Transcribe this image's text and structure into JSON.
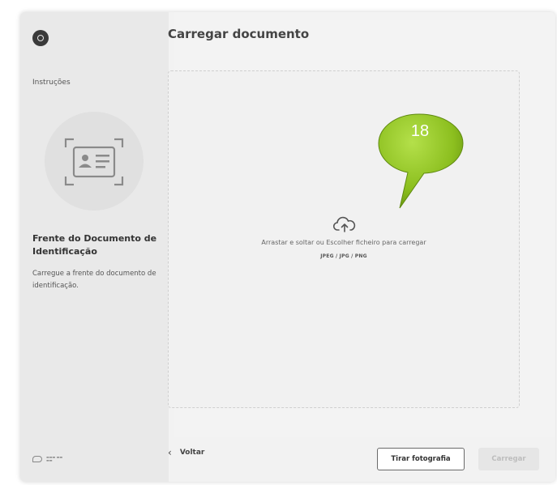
{
  "sidebar": {
    "instructions_label": "Instruções",
    "document_title": "Frente do Documento de Identificação",
    "document_description": "Carregue a frente do documento de identificação.",
    "info_icon": "info-icon",
    "id_card_icon": "id-card-icon",
    "brand_logo": "brand-logo"
  },
  "main": {
    "title": "Carregar documento",
    "dropzone": {
      "icon": "cloud-upload-icon",
      "instruction": "Arrastar e soltar ou Escolher ficheiro para carregar",
      "formats": "JPEG / JPG / PNG"
    },
    "callout": {
      "label": "18",
      "color": "#8cbf1f"
    }
  },
  "footer": {
    "back_label": "Voltar",
    "take_photo_label": "Tirar fotografia",
    "upload_label": "Carregar"
  },
  "colors": {
    "sidebar_bg": "#e9e9e9",
    "panel_bg": "#f3f3f3",
    "disabled_button_bg": "#e6e6e6",
    "callout_green": "#8cbf1f"
  }
}
